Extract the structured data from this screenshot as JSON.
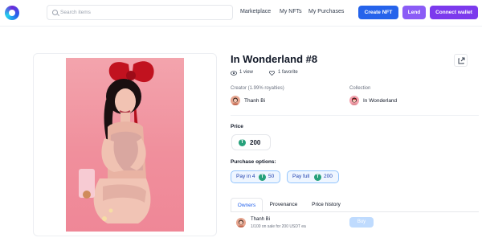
{
  "header": {
    "search_placeholder": "Search items",
    "nav": [
      "Marketplace",
      "My NFTs",
      "My Purchases"
    ],
    "create_label": "Create NFT",
    "lend_label": "Lend",
    "connect_label": "Connect wallet"
  },
  "nft": {
    "title": "In Wonderland #8",
    "views": "1 view",
    "favorites": "1 favorite",
    "creator_label": "Creator (1.99% royalties)",
    "creator_name": "Thanh Bi",
    "collection_label": "Collection",
    "collection_name": "In Wonderland"
  },
  "price": {
    "label": "Price",
    "value": "200",
    "currency_icon": "tether-icon"
  },
  "purchase": {
    "label": "Purchase options:",
    "pay_in_4_label": "Pay in 4",
    "pay_in_4_value": "50",
    "pay_full_label": "Pay full",
    "pay_full_value": "200"
  },
  "tabs": [
    "Owners",
    "Provenance",
    "Price history"
  ],
  "owners": [
    {
      "name": "Thanh Bi",
      "detail": "1/100 on sale for 200 USDT ea",
      "buy_label": "Buy"
    }
  ],
  "colors": {
    "primary": "#2563eb",
    "lend": "#8b5cf6",
    "connect": "#7c3aed",
    "tether": "#26a17b"
  }
}
